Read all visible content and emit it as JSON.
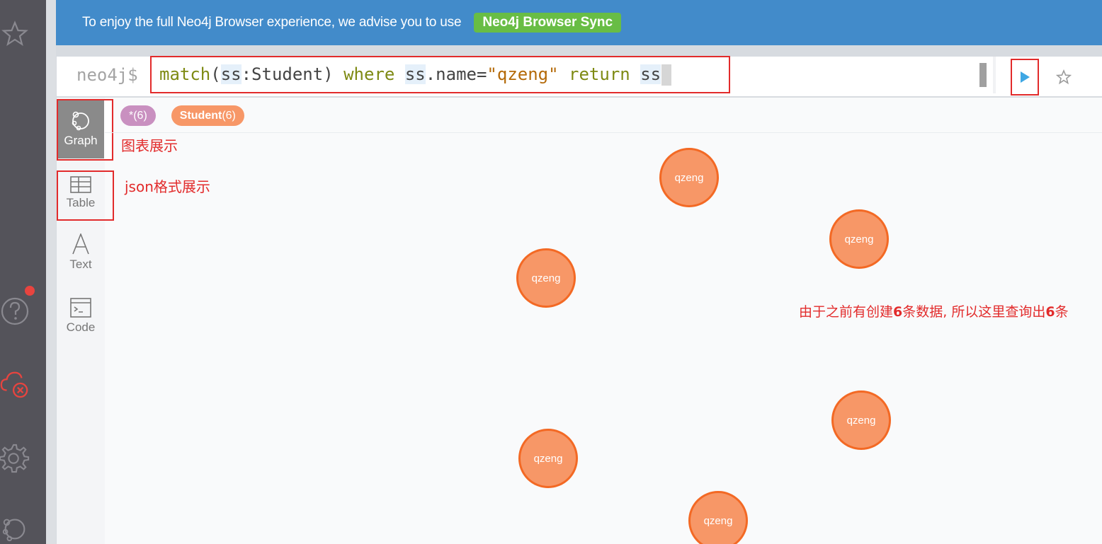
{
  "banner": {
    "text": "To enjoy the full Neo4j Browser experience, we advise you to use",
    "button": "Neo4j Browser Sync"
  },
  "editor": {
    "prompt": "neo4j$",
    "query_tokens": [
      "match",
      "(",
      "ss",
      ":Student) ",
      "where",
      " ",
      "ss",
      ".name=",
      "\"qzeng\"",
      " ",
      "return",
      " ",
      "ss"
    ]
  },
  "view_tabs": [
    {
      "label": "Graph",
      "icon": "graph-icon"
    },
    {
      "label": "Table",
      "icon": "table-icon"
    },
    {
      "label": "Text",
      "icon": "text-icon"
    },
    {
      "label": "Code",
      "icon": "code-icon"
    }
  ],
  "pills": {
    "all": "*(6)",
    "student_name": "Student",
    "student_count": "(6)"
  },
  "annotations": {
    "graph": "图表展示",
    "table_prefix": "json",
    "table_suffix": "格式展示",
    "result_a": "由于之前有创建",
    "result_num": "6",
    "result_b": "条数据, 所以这里查询出",
    "result_num2": "6",
    "result_c": "条"
  },
  "nodes": [
    {
      "label": "qzeng"
    },
    {
      "label": "qzeng"
    },
    {
      "label": "qzeng"
    },
    {
      "label": "qzeng"
    },
    {
      "label": "qzeng"
    },
    {
      "label": "qzeng"
    }
  ],
  "colors": {
    "banner": "#428bca",
    "sync_button": "#68bd45",
    "node_fill": "#f79767",
    "node_stroke": "#f36924",
    "annotation": "#e22b2b"
  }
}
